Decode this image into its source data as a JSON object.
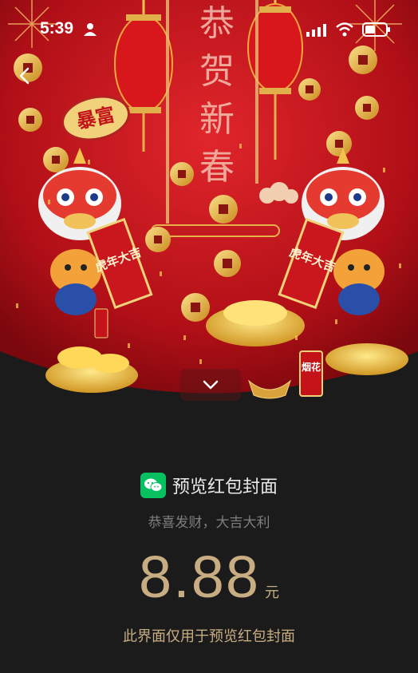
{
  "status_bar": {
    "time": "5:39",
    "icons": [
      "person-icon",
      "signal-icon",
      "wifi-icon",
      "battery-icon"
    ]
  },
  "cover": {
    "title_chars": [
      "恭",
      "贺",
      "新",
      "春"
    ],
    "badge_text": "暴富",
    "left_banner_text": "虎年大吉",
    "right_banner_text": "虎年大吉",
    "firecracker_text": "烟花",
    "colors": {
      "red": "#c8141c",
      "deep_red": "#8a0a10",
      "gold": "#e8b63c"
    }
  },
  "panel": {
    "brand_name": "预览红包封面",
    "greeting": "恭喜发财，大吉大利",
    "amount": "8.88",
    "currency": "元",
    "notice": "此界面仅用于预览红包封面",
    "colors": {
      "bg": "#1b1b1b",
      "gold_text": "#c8ad82",
      "wechat_green": "#07c160"
    }
  }
}
